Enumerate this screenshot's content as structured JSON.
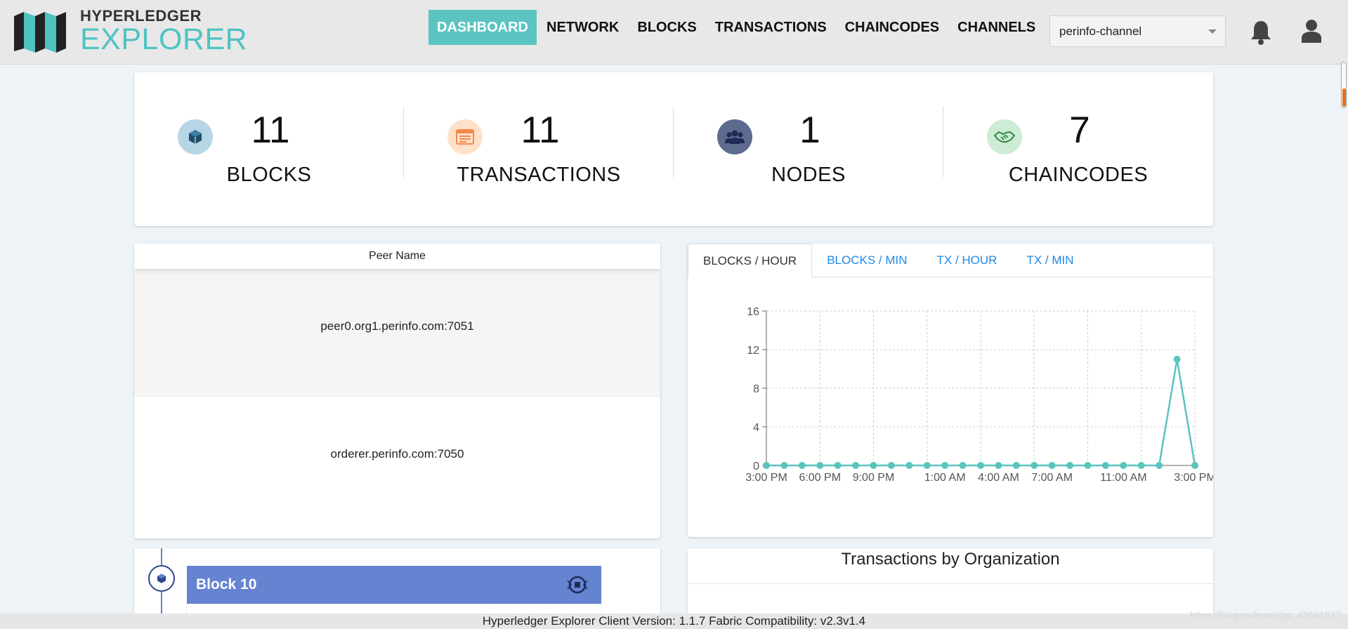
{
  "header": {
    "logo_top": "HYPERLEDGER",
    "logo_bottom": "EXPLORER",
    "nav": [
      {
        "label": "DASHBOARD",
        "active": true
      },
      {
        "label": "NETWORK",
        "active": false
      },
      {
        "label": "BLOCKS",
        "active": false
      },
      {
        "label": "TRANSACTIONS",
        "active": false
      },
      {
        "label": "CHAINCODES",
        "active": false
      },
      {
        "label": "CHANNELS",
        "active": false
      }
    ],
    "channel": "perinfo-channel"
  },
  "stats": [
    {
      "value": "11",
      "label": "BLOCKS",
      "icon": "cube-icon",
      "color": "#b6d6e5",
      "icon_color": "#1f4e6b"
    },
    {
      "value": "11",
      "label": "TRANSACTIONS",
      "icon": "list-icon",
      "color": "#ffe1c9",
      "icon_color": "#f28a4a"
    },
    {
      "value": "1",
      "label": "NODES",
      "icon": "users-icon",
      "color": "#5c6b8e",
      "icon_color": "#1d2a55"
    },
    {
      "value": "7",
      "label": "CHAINCODES",
      "icon": "handshake-icon",
      "color": "#cdebd5",
      "icon_color": "#2f8a45"
    }
  ],
  "peers": {
    "header": "Peer Name",
    "rows": [
      "peer0.org1.perinfo.com:7051",
      "orderer.perinfo.com:7050"
    ]
  },
  "chart_tabs": [
    {
      "label": "BLOCKS / HOUR",
      "active": true
    },
    {
      "label": "BLOCKS / MIN",
      "active": false
    },
    {
      "label": "TX / HOUR",
      "active": false
    },
    {
      "label": "TX / MIN",
      "active": false
    }
  ],
  "chart_data": {
    "type": "line",
    "x_tick_labels": [
      "3:00 PM",
      "6:00 PM",
      "9:00 PM",
      "1:00 AM",
      "4:00 AM",
      "7:00 AM",
      "11:00 AM",
      "3:00 PM"
    ],
    "y_ticks": [
      0,
      4,
      8,
      12,
      16
    ],
    "ylim": [
      0,
      16
    ],
    "grid": true,
    "color": "#5bc4c0",
    "series": [
      {
        "values": [
          0,
          0,
          0,
          0,
          0,
          0,
          0,
          0,
          0,
          0,
          0,
          0,
          0,
          0,
          0,
          0,
          0,
          0,
          0,
          0,
          0,
          0,
          0,
          11,
          0
        ]
      }
    ]
  },
  "block_timeline": {
    "title": "Block 10"
  },
  "org_card": {
    "title": "Transactions by Organization"
  },
  "footer": "Hyperledger Explorer Client Version: 1.1.7    Fabric Compatibility: v2.3v1.4",
  "watermark": "https://blog.csdn.net/qq_43681877"
}
